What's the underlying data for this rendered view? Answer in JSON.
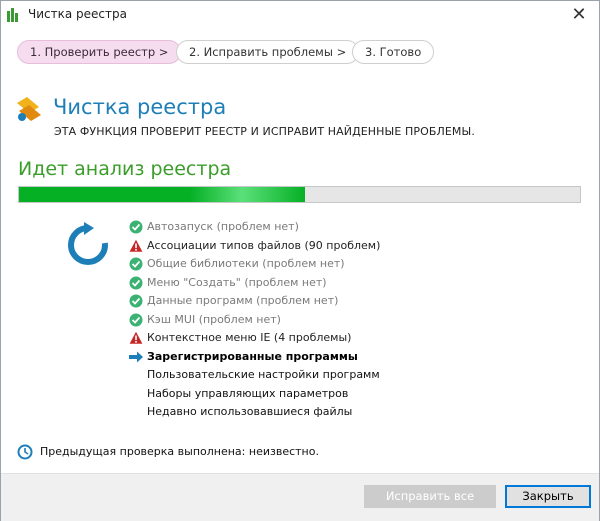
{
  "window": {
    "title": "Чистка реестра"
  },
  "steps": [
    {
      "label": "1. Проверить реестр >"
    },
    {
      "label": "2. Исправить проблемы >"
    },
    {
      "label": "3. Готово"
    }
  ],
  "header": {
    "title": "Чистка реестра",
    "subtitle": "ЭТА ФУНКЦИЯ ПРОВЕРИТ РЕЕСТР И ИСПРАВИТ НАЙДЕННЫЕ ПРОБЛЕМЫ."
  },
  "analysis": {
    "title": "Идет анализ реестра",
    "progress_fraction": 0.51
  },
  "checklist": [
    {
      "label": "Автозапуск (проблем нет)",
      "state": "done",
      "icon": "check-circle-icon"
    },
    {
      "label": "Ассоциации типов файлов (90 проблем)",
      "state": "warning",
      "icon": "warning-icon"
    },
    {
      "label": "Общие библиотеки (проблем нет)",
      "state": "done",
      "icon": "check-circle-icon"
    },
    {
      "label": "Меню \"Создать\" (проблем нет)",
      "state": "done",
      "icon": "check-circle-icon"
    },
    {
      "label": "Данные программ (проблем нет)",
      "state": "done",
      "icon": "check-circle-icon"
    },
    {
      "label": "Кэш MUI (проблем нет)",
      "state": "done",
      "icon": "check-circle-icon"
    },
    {
      "label": "Контекстное меню IE (4 проблемы)",
      "state": "warning",
      "icon": "warning-icon"
    },
    {
      "label": "Зарегистрированные программы",
      "state": "current",
      "icon": "arrow-right-icon"
    },
    {
      "label": "Пользовательские настройки программ",
      "state": "pending",
      "icon": ""
    },
    {
      "label": "Наборы управляющих параметров",
      "state": "pending",
      "icon": ""
    },
    {
      "label": "Недавно использовавшиеся файлы",
      "state": "pending",
      "icon": ""
    }
  ],
  "status": {
    "text": "Предыдущая проверка выполнена: неизвестно."
  },
  "buttons": {
    "fix_label": "Исправить все",
    "close_label": "Закрыть"
  },
  "colors": {
    "accent_blue": "#1e7fb8",
    "accent_green": "#3b9d2a",
    "progress_green": "#06b025",
    "active_step_bg": "#f6dcef",
    "warning_red": "#c62828",
    "check_green": "#3bb273"
  }
}
